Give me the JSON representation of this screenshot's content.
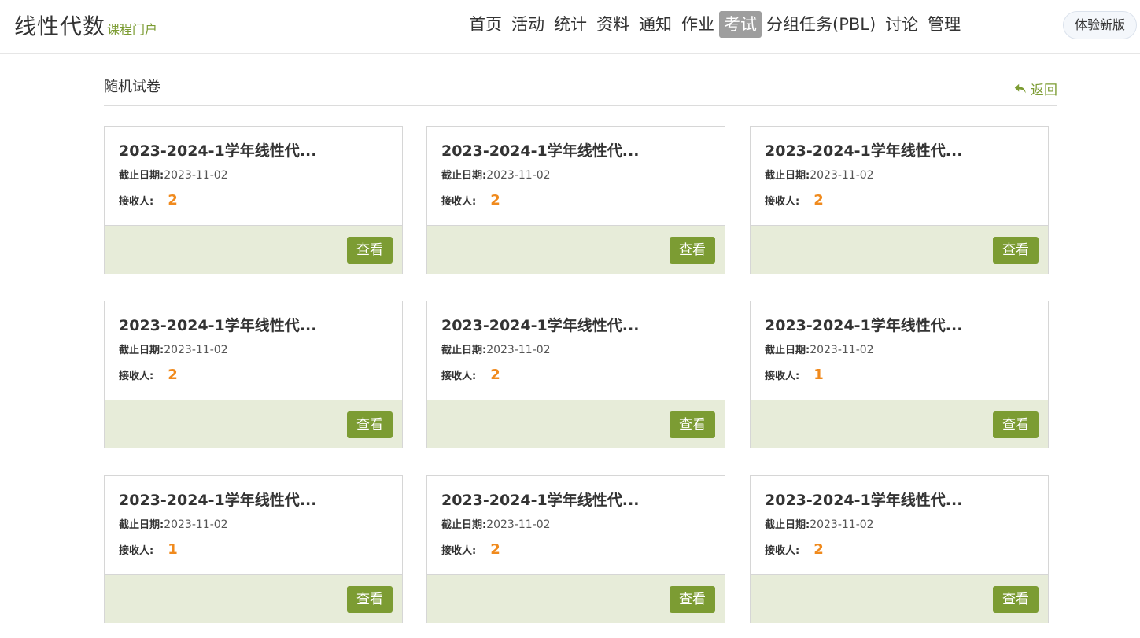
{
  "header": {
    "title": "线性代数",
    "subtitle": "课程门户",
    "nav": [
      "首页",
      "活动",
      "统计",
      "资料",
      "通知",
      "作业",
      "考试",
      "分组任务(PBL)",
      "讨论",
      "管理"
    ],
    "active_nav": "考试",
    "trial_button": "体验新版"
  },
  "page": {
    "title": "随机试卷",
    "back_label": "返回"
  },
  "labels": {
    "deadline": "截止日期:",
    "recipients": "接收人:",
    "view": "查看"
  },
  "colors": {
    "accent": "#7c9c33",
    "count": "#f08a1d",
    "card_footer": "#e7ecd9"
  },
  "cards": [
    {
      "name": "2023-2024-1学年线性代...",
      "deadline": "2023-11-02",
      "recipients": "2"
    },
    {
      "name": "2023-2024-1学年线性代...",
      "deadline": "2023-11-02",
      "recipients": "2"
    },
    {
      "name": "2023-2024-1学年线性代...",
      "deadline": "2023-11-02",
      "recipients": "2"
    },
    {
      "name": "2023-2024-1学年线性代...",
      "deadline": "2023-11-02",
      "recipients": "2"
    },
    {
      "name": "2023-2024-1学年线性代...",
      "deadline": "2023-11-02",
      "recipients": "2"
    },
    {
      "name": "2023-2024-1学年线性代...",
      "deadline": "2023-11-02",
      "recipients": "1"
    },
    {
      "name": "2023-2024-1学年线性代...",
      "deadline": "2023-11-02",
      "recipients": "1"
    },
    {
      "name": "2023-2024-1学年线性代...",
      "deadline": "2023-11-02",
      "recipients": "2"
    },
    {
      "name": "2023-2024-1学年线性代...",
      "deadline": "2023-11-02",
      "recipients": "2"
    }
  ]
}
